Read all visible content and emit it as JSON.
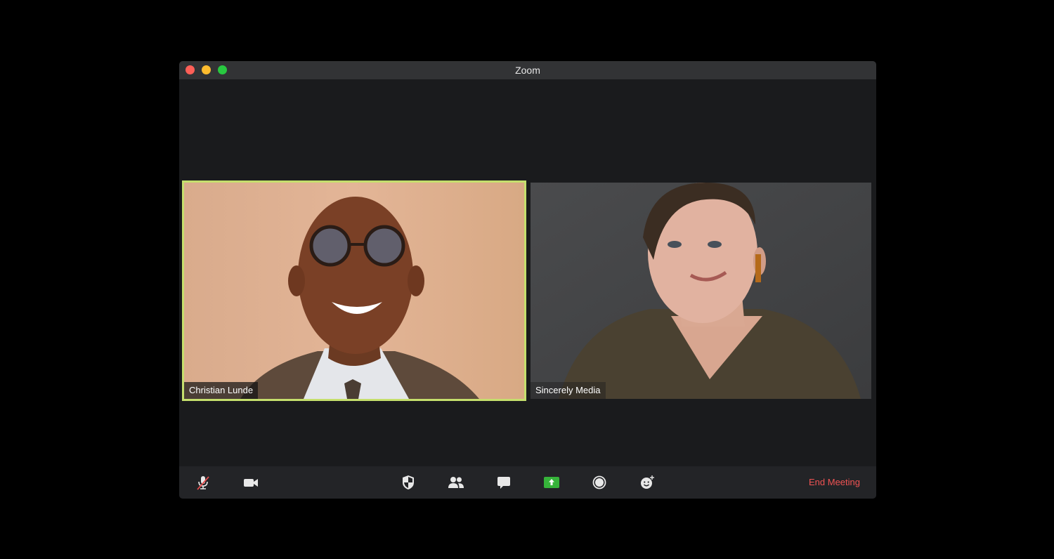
{
  "window": {
    "title": "Zoom"
  },
  "participants": [
    {
      "name": "Christian Lunde",
      "active_speaker": true
    },
    {
      "name": "Sincerely Media",
      "active_speaker": false
    }
  ],
  "toolbar": {
    "buttons": [
      {
        "icon": "microphone-muted-icon"
      },
      {
        "icon": "video-camera-icon"
      },
      {
        "icon": "shield-icon"
      },
      {
        "icon": "participants-icon"
      },
      {
        "icon": "chat-icon"
      },
      {
        "icon": "share-screen-icon"
      },
      {
        "icon": "record-icon"
      },
      {
        "icon": "reactions-icon"
      }
    ],
    "end_label": "End Meeting"
  },
  "colors": {
    "active_speaker_border": "#c5df6d",
    "end_meeting": "#f05353",
    "share_screen": "#36b33a"
  }
}
